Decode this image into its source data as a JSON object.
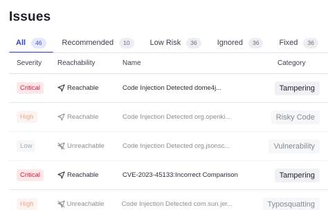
{
  "page": {
    "title": "Issues"
  },
  "tabs": [
    {
      "label": "All",
      "count": "46"
    },
    {
      "label": "Recommended",
      "count": "10"
    },
    {
      "label": "Low Risk",
      "count": "36"
    },
    {
      "label": "Ignored",
      "count": "36"
    },
    {
      "label": "Fixed",
      "count": "36"
    }
  ],
  "columns": {
    "severity": "Severity",
    "reachability": "Reachability",
    "name": "Name",
    "category": "Category"
  },
  "rows": [
    {
      "severity": "Critical",
      "reachability": "Reachable",
      "name": "Code Injection Detected dome4j...",
      "category": "Tampering"
    },
    {
      "severity": "High",
      "reachability": "Reachable",
      "name": "Code Injection Detected org.openki...",
      "category": "Risky Code"
    },
    {
      "severity": "Low",
      "reachability": "Unreachable",
      "name": "Code Injection Detected org.jsonsc...",
      "category": "Vulnerability"
    },
    {
      "severity": "Critical",
      "reachability": "Reachable",
      "name": "CVE-2023-45133:Incorrect Comparison",
      "category": "Tampering"
    },
    {
      "severity": "High",
      "reachability": "Unreachable",
      "name": "Code Injection Detected com.sun.jer...",
      "category": "Typosquatting"
    }
  ]
}
